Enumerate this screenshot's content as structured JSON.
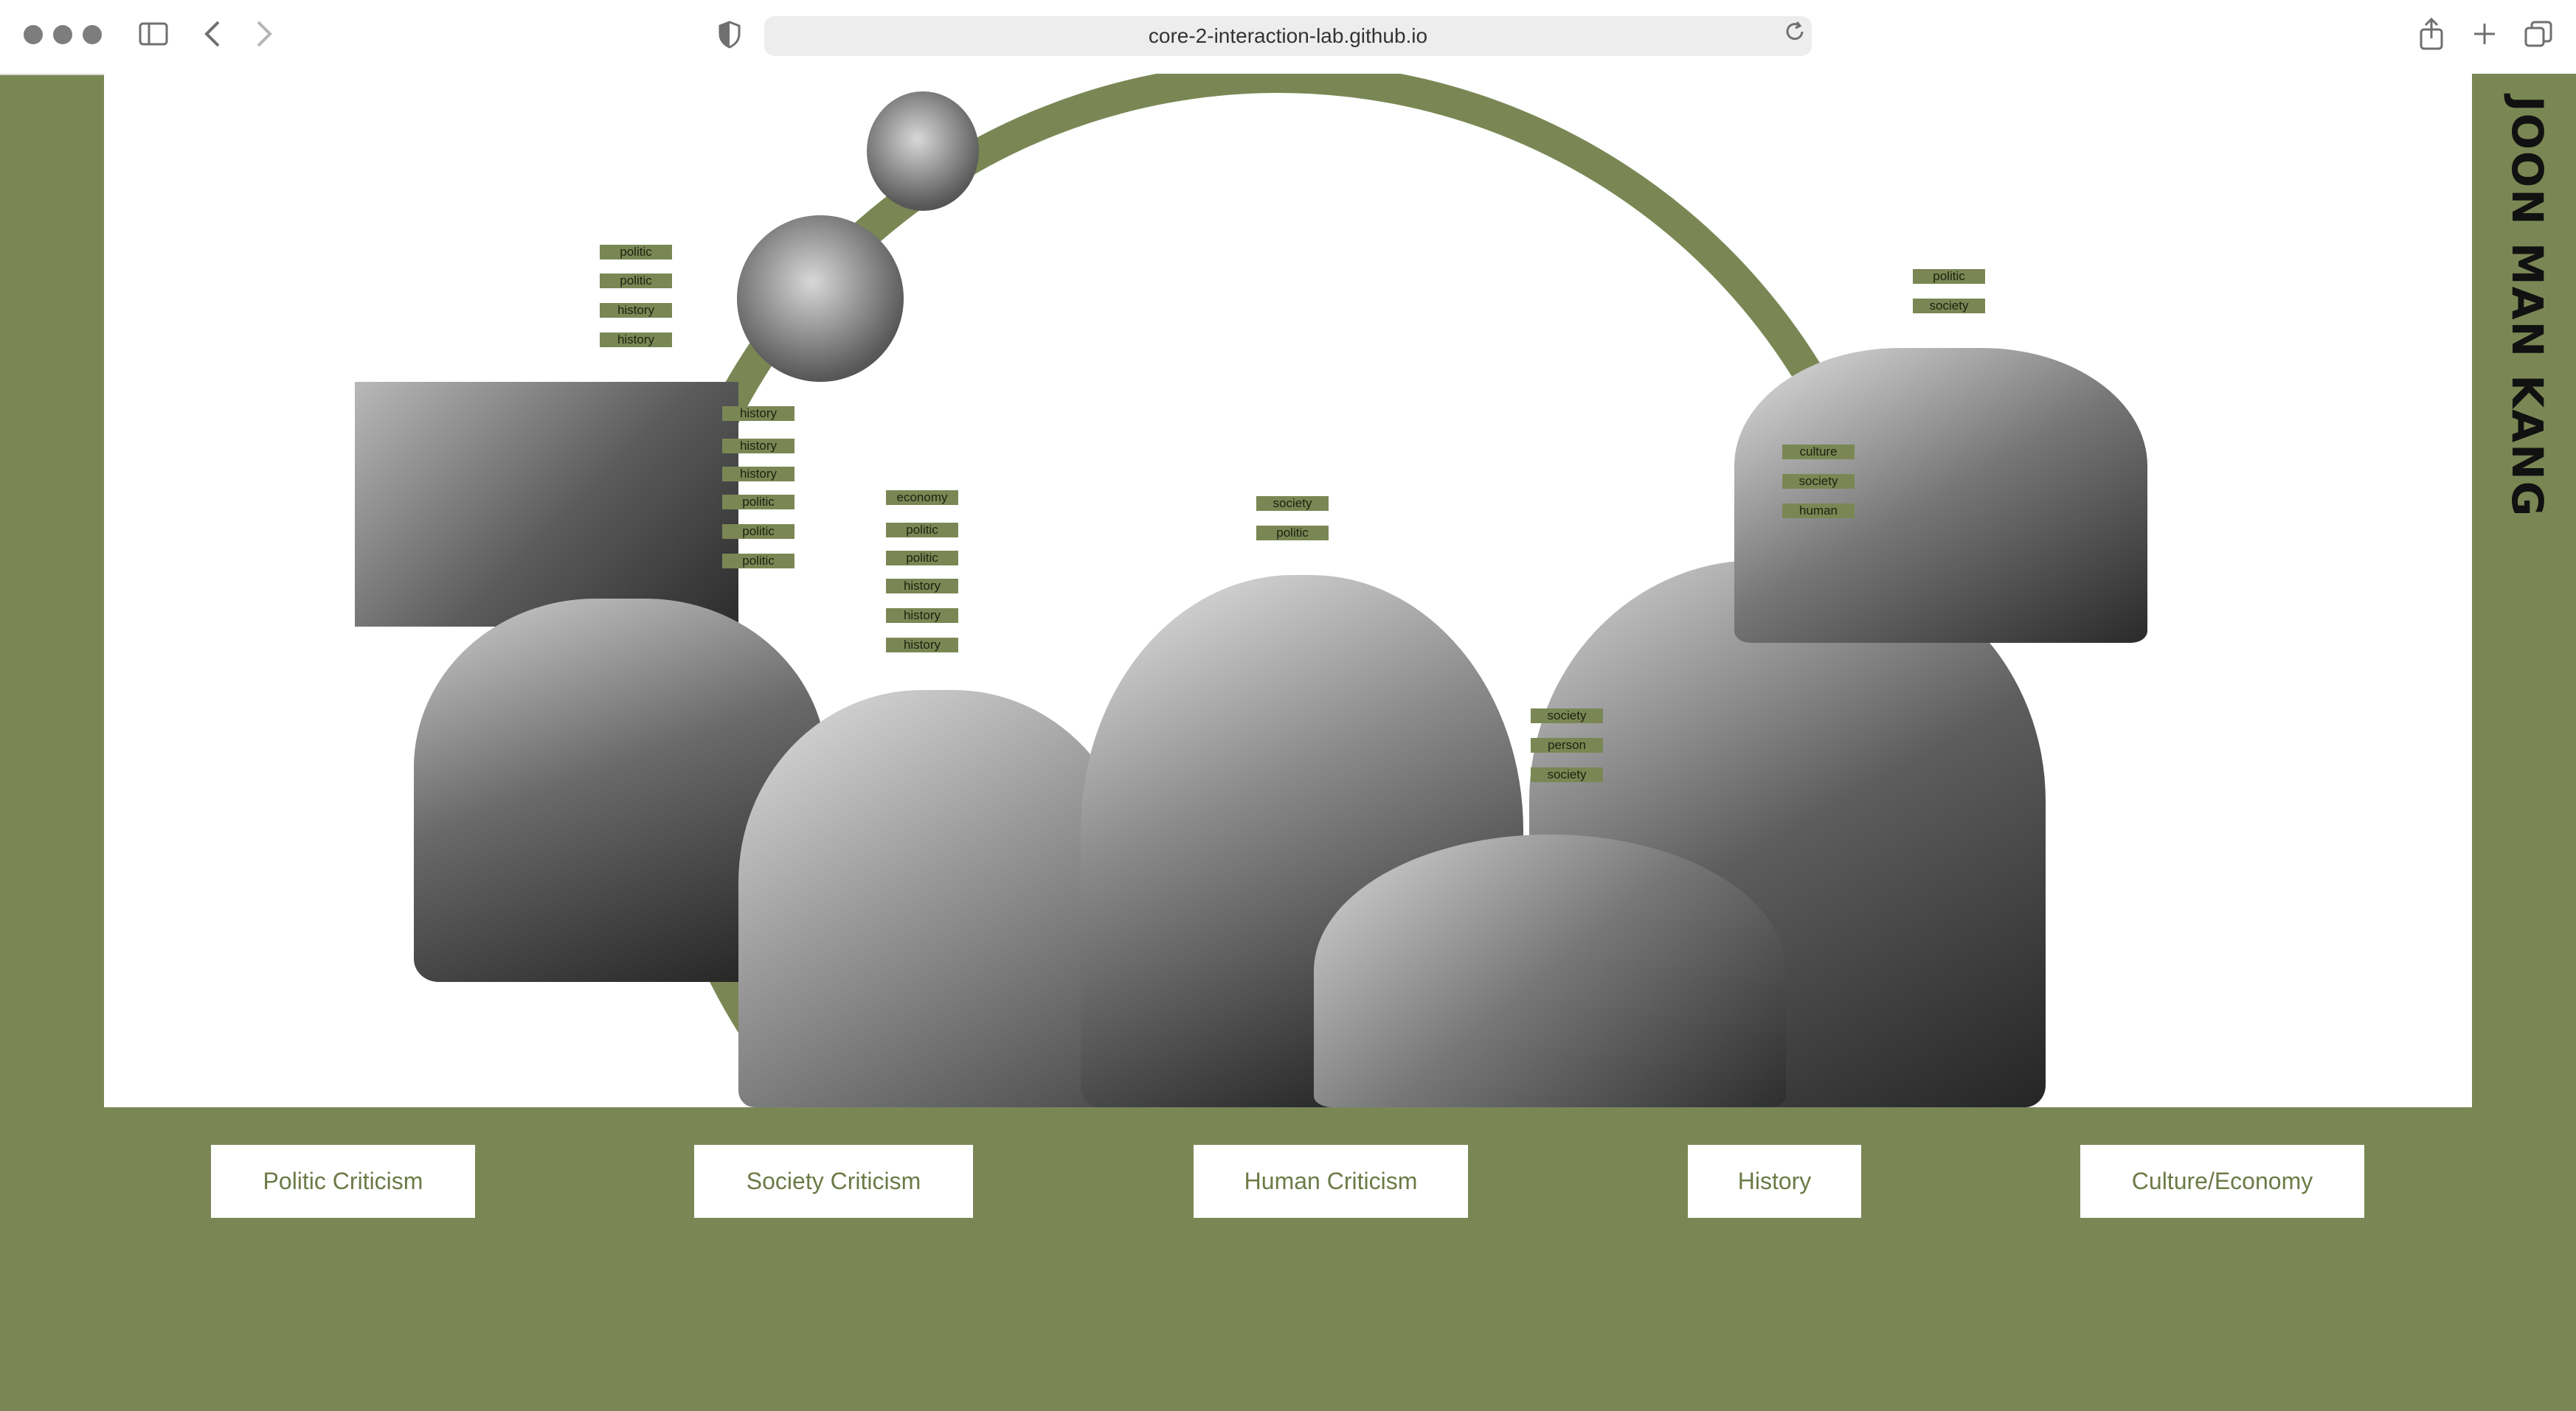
{
  "browser": {
    "url": "core-2-interaction-lab.github.io"
  },
  "site": {
    "title": "JOON MAN KANG"
  },
  "tags": {
    "group_a": [
      "politic",
      "politic",
      "history",
      "history"
    ],
    "group_b": [
      "history",
      "history",
      "history",
      "politic",
      "politic",
      "politic"
    ],
    "group_c": [
      "economy",
      "politic",
      "politic",
      "history",
      "history",
      "history"
    ],
    "group_d": [
      "society",
      "politic"
    ],
    "group_e": [
      "politic",
      "society"
    ],
    "group_f": [
      "culture",
      "society",
      "human"
    ],
    "group_g": [
      "society",
      "person",
      "society"
    ]
  },
  "nav": {
    "politic": "Politic Criticism",
    "society": "Society Criticism",
    "human": "Human Criticism",
    "history": "History",
    "culture": "Culture/Economy"
  }
}
